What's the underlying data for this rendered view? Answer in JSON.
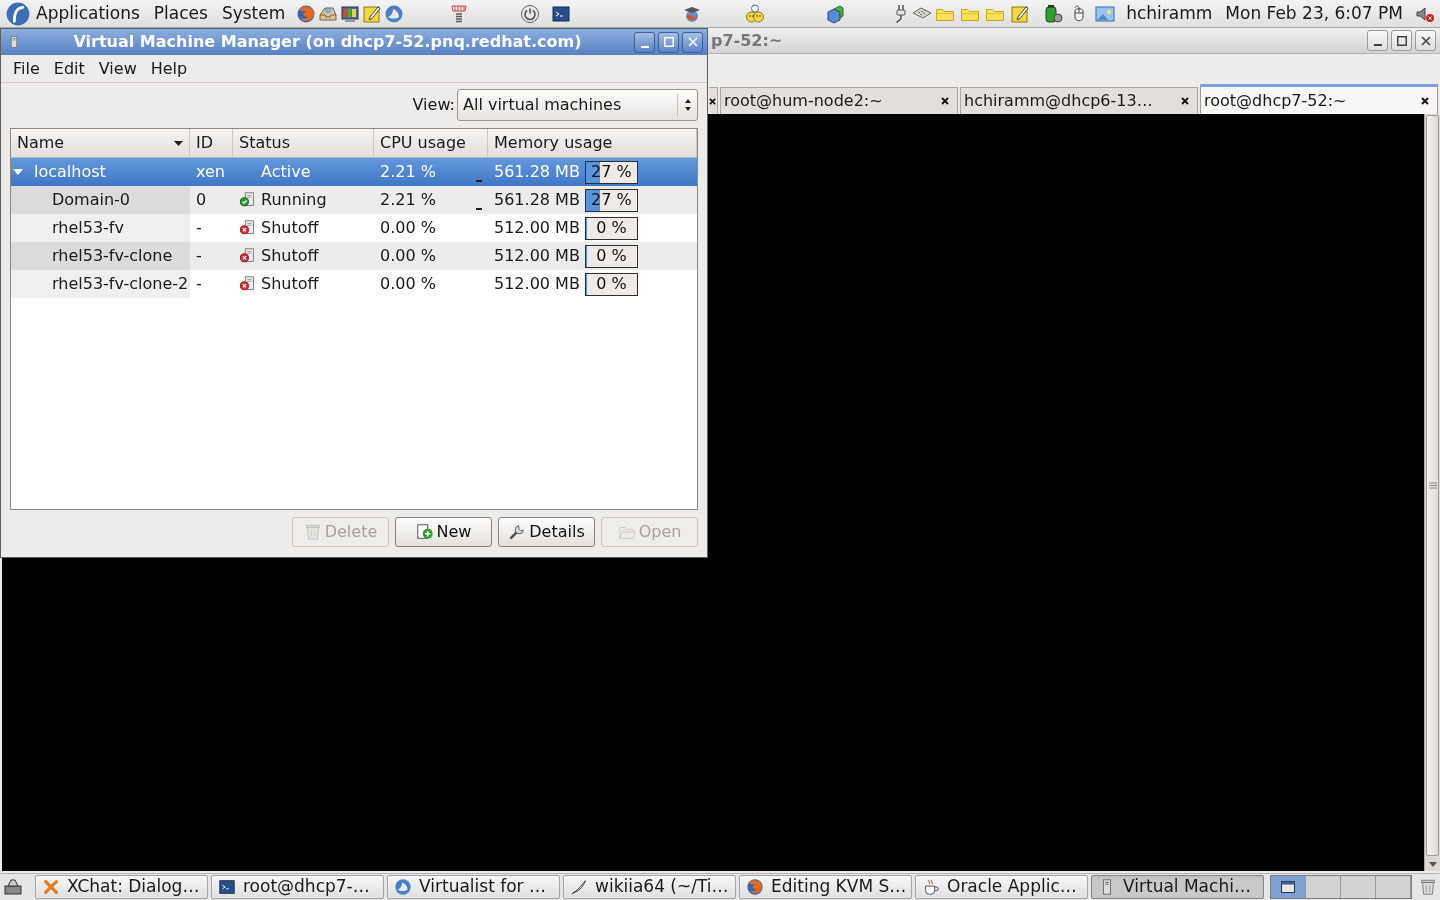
{
  "top_panel": {
    "menus": [
      "Applications",
      "Places",
      "System"
    ],
    "user": "hchiramm",
    "clock": "Mon Feb 23, 6:07 PM"
  },
  "terminal_window": {
    "title": "p7-52:~",
    "active": false,
    "tabs": [
      {
        "selected": false
      },
      {
        "label": "root@hum-node2:~",
        "selected": false
      },
      {
        "label": "hchiramm@dhcp6-13…",
        "selected": false
      },
      {
        "label": "root@dhcp7-52:~",
        "selected": true
      }
    ]
  },
  "manager_window": {
    "title": "Virtual Machine Manager (on dhcp7-52.pnq.redhat.com)",
    "active": true,
    "menus": [
      "File",
      "Edit",
      "View",
      "Help"
    ],
    "view_filter": {
      "label": "View:",
      "value": "All virtual machines"
    },
    "table": {
      "columns": [
        {
          "label": "Name",
          "sorted": true
        },
        {
          "label": "ID",
          "sorted": false
        },
        {
          "label": "Status",
          "sorted": false
        },
        {
          "label": "CPU usage",
          "sorted": false
        },
        {
          "label": "Memory usage",
          "sorted": false
        }
      ],
      "rows": [
        {
          "name": "localhost",
          "id": "xen",
          "status": "Active",
          "cpu": "2.21 %",
          "cpu_graph": true,
          "memory": "561.28 MB",
          "memory_percent": "27 %",
          "level": 0.27,
          "selected": true,
          "expanded": true,
          "children": [
            {
              "name": "Domain-0",
              "kind": "running",
              "id": "0",
              "status": "Running",
              "cpu": "2.21 %",
              "cpu_graph": true,
              "memory": "561.28 MB",
              "memory_percent": "27 %",
              "level": 0.27,
              "selected": false
            },
            {
              "name": "rhel53-fv",
              "kind": "shutoff",
              "id": "-",
              "status": "Shutoff",
              "cpu": "0.00 %",
              "cpu_graph": false,
              "memory": "512.00 MB",
              "memory_percent": "0 %",
              "level": 0,
              "selected": false
            },
            {
              "name": "rhel53-fv-clone",
              "kind": "shutoff",
              "id": "-",
              "status": "Shutoff",
              "cpu": "0.00 %",
              "cpu_graph": false,
              "memory": "512.00 MB",
              "memory_percent": "0 %",
              "level": 0,
              "selected": false
            },
            {
              "name": "rhel53-fv-clone-2",
              "kind": "shutoff",
              "id": "-",
              "status": "Shutoff",
              "cpu": "0.00 %",
              "cpu_graph": false,
              "memory": "512.00 MB",
              "memory_percent": "0 %",
              "level": 0,
              "selected": false
            }
          ]
        }
      ]
    },
    "buttons": [
      {
        "label": "Delete",
        "disabled": true
      },
      {
        "label": "New",
        "disabled": false
      },
      {
        "label": "Details",
        "disabled": false
      },
      {
        "label": "Open",
        "disabled": true
      }
    ]
  },
  "taskbar": {
    "tasks": [
      {
        "label": "XChat: Dialog…",
        "selected": false
      },
      {
        "label": "root@dhcp7-…",
        "selected": false
      },
      {
        "label": "Virtualist for …",
        "selected": false
      },
      {
        "label": "wikiia64 (~/Ti…",
        "selected": false
      },
      {
        "label": "Editing KVM S…",
        "selected": false
      },
      {
        "label": "Oracle Applic…",
        "selected": false
      },
      {
        "label": "Virtual Machi…",
        "selected": true
      }
    ],
    "workspaces": [
      {
        "selected": true
      },
      {
        "selected": false
      },
      {
        "selected": false
      },
      {
        "selected": false
      }
    ]
  }
}
